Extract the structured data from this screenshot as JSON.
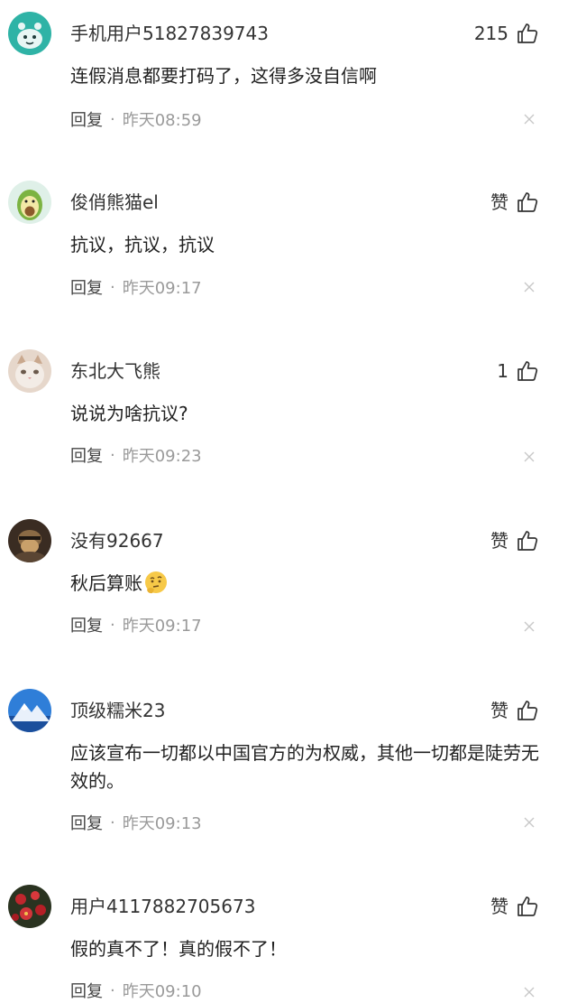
{
  "comments": [
    {
      "username": "手机用户51827839743",
      "like_label": "215",
      "content": "连假消息都要打码了，这得多没自信啊",
      "reply_label": "回复",
      "separator": "·",
      "time": "昨天08:59",
      "avatar_icon": "teal-creature-avatar"
    },
    {
      "username": "俊俏熊猫el",
      "like_label": "赞",
      "content": "抗议，抗议，抗议",
      "reply_label": "回复",
      "separator": "·",
      "time": "昨天09:17",
      "avatar_icon": "avocado-avatar"
    },
    {
      "username": "东北大飞熊",
      "like_label": "1",
      "content": "说说为啥抗议?",
      "reply_label": "回复",
      "separator": "·",
      "time": "昨天09:23",
      "avatar_icon": "cat-avatar"
    },
    {
      "username": "没有92667",
      "like_label": "赞",
      "content": "秋后算账",
      "content_emoji": "thinking-emoji",
      "reply_label": "回复",
      "separator": "·",
      "time": "昨天09:17",
      "avatar_icon": "dark-photo-avatar"
    },
    {
      "username": "顶级糯米23",
      "like_label": "赞",
      "content": "应该宣布一切都以中国官方的为权威，其他一切都是陡劳无效的。",
      "reply_label": "回复",
      "separator": "·",
      "time": "昨天09:13",
      "avatar_icon": "snow-mountain-avatar"
    },
    {
      "username": "用户4117882705673",
      "like_label": "赞",
      "content": "假的真不了！真的假不了！",
      "reply_label": "回复",
      "separator": "·",
      "time": "昨天09:10",
      "avatar_icon": "red-flowers-avatar"
    }
  ],
  "colors": {
    "text_primary": "#222222",
    "text_secondary": "#555555",
    "time_gray": "#9a9a9a",
    "icon_gray": "#333333"
  }
}
